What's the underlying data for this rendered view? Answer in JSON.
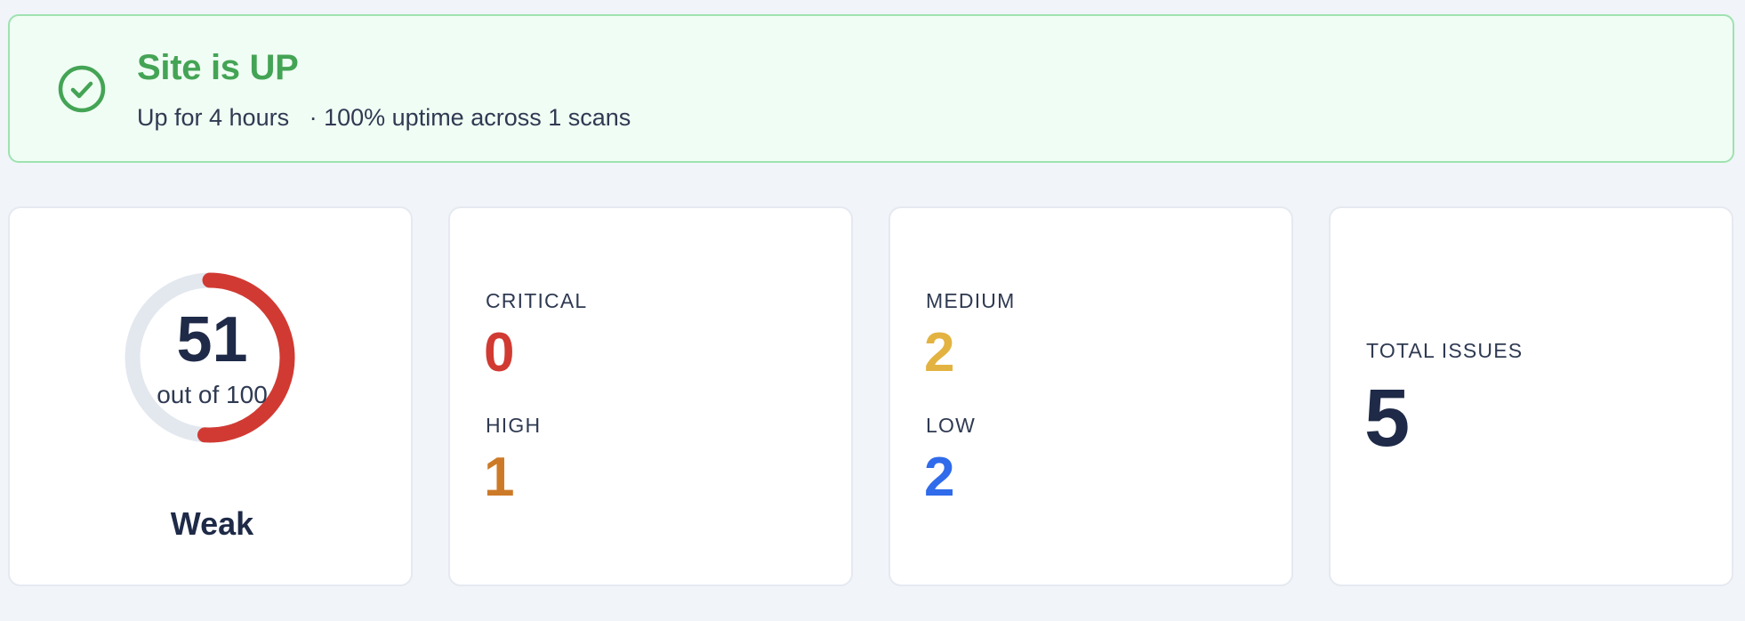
{
  "status": {
    "title": "Site is UP",
    "uptime_duration": "Up for 4 hours",
    "uptime_detail": "· 100% uptime across 1 scans",
    "icon": "check-circle-icon",
    "color": "#44a455"
  },
  "score": {
    "value": "51",
    "max_label": "out of 100",
    "fraction": 0.51,
    "rating": "Weak",
    "track_color": "#e3e8ef",
    "progress_color": "#d13a32"
  },
  "severity": {
    "critical": {
      "label": "CRITICAL",
      "count": "0",
      "color": "#d13a32"
    },
    "high": {
      "label": "HIGH",
      "count": "1",
      "color": "#cd7a28"
    },
    "medium": {
      "label": "MEDIUM",
      "count": "2",
      "color": "#e3b341"
    },
    "low": {
      "label": "LOW",
      "count": "2",
      "color": "#2f6bea"
    }
  },
  "total": {
    "label": "TOTAL ISSUES",
    "count": "5"
  }
}
